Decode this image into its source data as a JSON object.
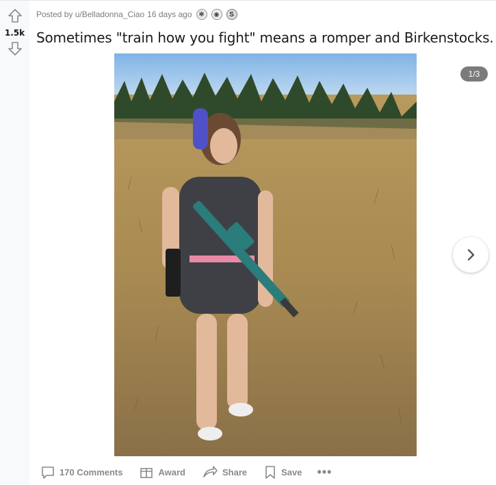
{
  "post": {
    "votes": "1.5k",
    "posted_by_prefix": "Posted by",
    "username": "u/Belladonna_Ciao",
    "time_ago": "16 days ago",
    "title": "Sometimes \"train how you fight\" means a romper and Birkenstocks.",
    "gallery_counter": "1/3",
    "awards": [
      "award-icon",
      "award-icon",
      "award-icon"
    ]
  },
  "actions": {
    "comments": "170 Comments",
    "award": "Award",
    "share": "Share",
    "save": "Save",
    "more": "•••"
  },
  "colors": {
    "meta_text": "#787c7e",
    "action_text": "#878a8c",
    "vote_column_bg": "#f8f9fa"
  }
}
